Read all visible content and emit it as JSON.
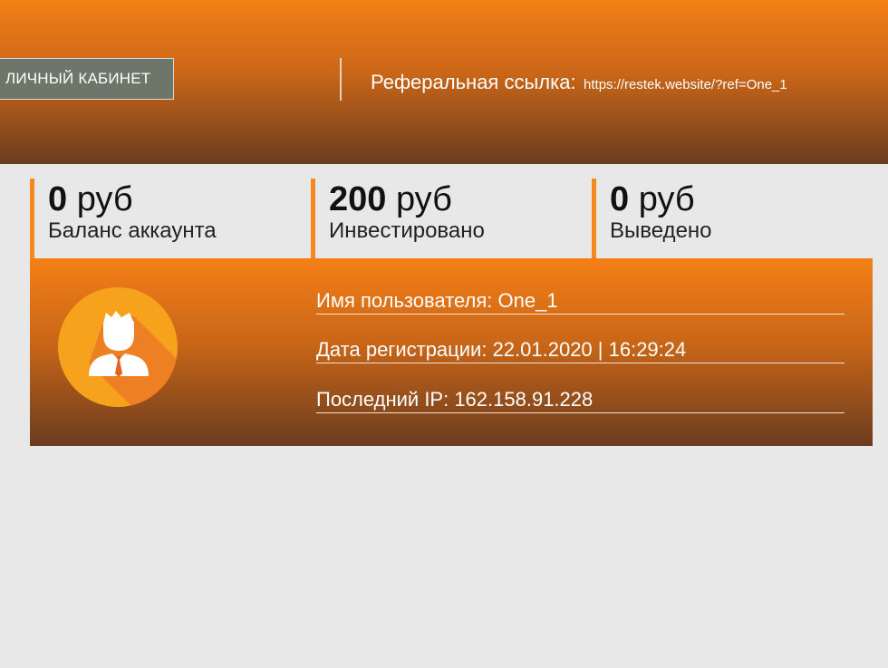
{
  "header": {
    "cabinet_button": "ЛИЧНЫЙ КАБИНЕТ",
    "referral_label": "Реферальная ссылка:",
    "referral_link": "https://restek.website/?ref=One_1"
  },
  "stats": [
    {
      "amount": "0",
      "unit": "руб",
      "label": "Баланс аккаунта"
    },
    {
      "amount": "200",
      "unit": "руб",
      "label": "Инвестировано"
    },
    {
      "amount": "0",
      "unit": "руб",
      "label": "Выведено"
    }
  ],
  "profile": {
    "username": "Имя пользователя: One_1",
    "registration": "Дата регистрации: 22.01.2020 | 16:29:24",
    "last_ip": "Последний IP: 162.158.91.228",
    "avatar_icon": "user-icon"
  },
  "colors": {
    "accent": "#f5891f",
    "gradient_top": "#f47f16",
    "gradient_bottom": "#6b3c1e",
    "avatar_circle": "#f6a21c",
    "background": "#e8e8e8"
  }
}
